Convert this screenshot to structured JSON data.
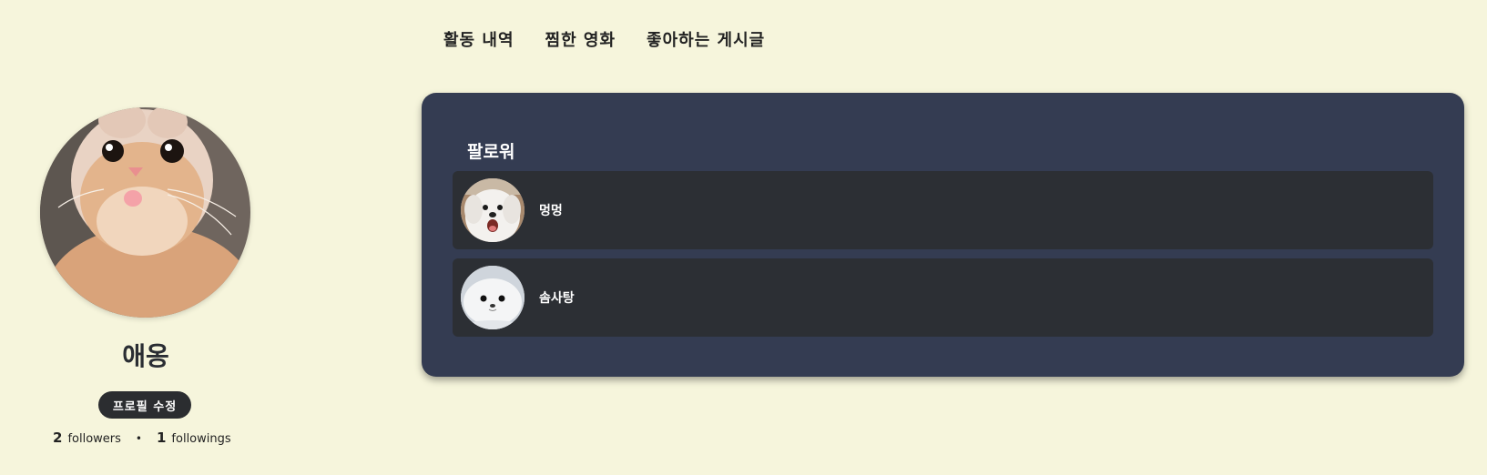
{
  "nav": {
    "tabs": [
      {
        "label": "활동 내역"
      },
      {
        "label": "찜한 영화"
      },
      {
        "label": "좋아하는 게시글"
      }
    ]
  },
  "profile": {
    "name": "애옹",
    "avatar_icon": "cat-photo",
    "edit_button_label": "프로필 수정",
    "followers_count": "2",
    "followers_label": "followers",
    "separator": "•",
    "followings_count": "1",
    "followings_label": "followings"
  },
  "followers_panel": {
    "title": "팔로워",
    "items": [
      {
        "name": "멍멍",
        "avatar_icon": "puppy-photo"
      },
      {
        "name": "솜사탕",
        "avatar_icon": "seal-photo"
      }
    ]
  },
  "colors": {
    "background": "#f6f5dc",
    "panel": "#343c52",
    "item": "#2c2f34",
    "button": "#2b2d30"
  }
}
